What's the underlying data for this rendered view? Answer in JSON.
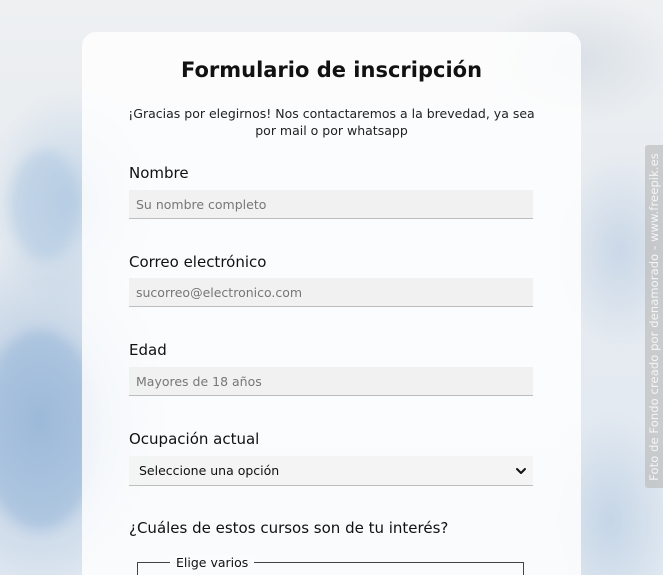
{
  "form": {
    "title": "Formulario de inscripción",
    "subtitle": "¡Gracias por elegirnos! Nos contactaremos a la brevedad, ya sea por mail o por whatsapp",
    "fields": [
      {
        "label": "Nombre",
        "placeholder": "Su nombre completo"
      },
      {
        "label": "Correo electrónico",
        "placeholder": "sucorreo@electronico.com"
      },
      {
        "label": "Edad",
        "placeholder": "Mayores de 18 años"
      }
    ],
    "occupation": {
      "label": "Ocupación actual",
      "selected": "Seleccione una opción"
    },
    "courses": {
      "question": "¿Cuáles de estos cursos son de tu interés?",
      "legend": "Elige varios"
    }
  },
  "watermark": {
    "text": "Foto de Fondo creado por denamorado - www.freepik.es"
  },
  "icons": {
    "select": "chevron-down-icon"
  },
  "colors": {
    "card_background": "#ffffff",
    "input_background": "#eeeeee",
    "text": "#111111",
    "watermark_background": "#bebebe"
  }
}
